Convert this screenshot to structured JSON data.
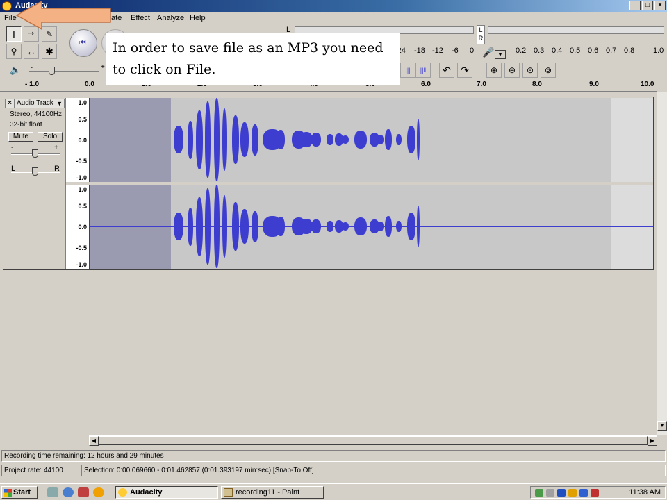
{
  "window": {
    "title": "Audacity",
    "min": "_",
    "max": "□",
    "close": "×"
  },
  "menu": {
    "file": "File",
    "generate": "ate",
    "effect": "Effect",
    "analyze": "Analyze",
    "help": "Help"
  },
  "meter": {
    "left_label": "L",
    "right_label": "R",
    "lr": "L\nR",
    "ticks": [
      "-24",
      "-18",
      "-12",
      "-6",
      "0"
    ],
    "scale_ticks": [
      "0.2",
      "0.3",
      "0.4",
      "0.5",
      "0.6",
      "0.7",
      "0.8",
      "1.0"
    ]
  },
  "ruler": {
    "ticks": [
      "- 1.0",
      "0.0",
      "1.0",
      "2.0",
      "3.0",
      "4.0",
      "5.0",
      "6.0",
      "7.0",
      "8.0",
      "9.0",
      "10.0"
    ]
  },
  "track": {
    "name": "Audio Track",
    "format": "Stereo, 44100Hz",
    "bitdepth": "32-bit float",
    "mute": "Mute",
    "solo": "Solo",
    "gain_minus": "-",
    "gain_plus": "+",
    "pan_left": "L",
    "pan_right": "R",
    "scale": [
      "1.0",
      "0.5",
      "0.0",
      "-0.5",
      "-1.0"
    ]
  },
  "status": {
    "recording": "Recording time remaining: 12 hours and 29 minutes",
    "rate_label": "Project rate:",
    "rate_value": "44100",
    "selection": "Selection: 0:00.069660 - 0:01.462857 (0:01.393197 min:sec)  [Snap-To Off]"
  },
  "taskbar": {
    "start": "Start",
    "app1": "Audacity",
    "app2": "recording11 - Paint",
    "clock": "11:38 AM"
  },
  "callout": {
    "text": "In order to save file as an MP3 you need to click on File."
  },
  "colors": {
    "wave": "#3d3dd0",
    "selection": "#9a9ab0",
    "callout_arrow": "#f4b183",
    "title_start": "#0a246a"
  }
}
